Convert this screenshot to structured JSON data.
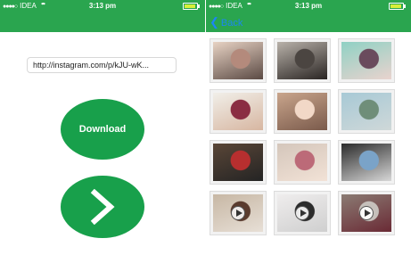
{
  "colors": {
    "brand_green": "#2aa54f",
    "button_green": "#18a04b",
    "back_blue": "#1c86f2"
  },
  "status_bar": {
    "carrier": "IDEA",
    "time": "3:13 pm",
    "battery_level": 0.9
  },
  "left_screen": {
    "url_field": {
      "value": "http://instagram.com/p/kJU-wK..."
    },
    "download_button": {
      "label": "Download"
    },
    "next_button": {
      "icon": "chevron-right-icon"
    }
  },
  "right_screen": {
    "back_button": {
      "label": "Back",
      "icon": "chevron-left-icon"
    },
    "grid": [
      {
        "kind": "photo",
        "colors": [
          "#e8d3c4",
          "#b48a7c",
          "#5b4a44"
        ]
      },
      {
        "kind": "photo",
        "colors": [
          "#b9b2aa",
          "#4b4541",
          "#2a2523"
        ]
      },
      {
        "kind": "photo",
        "colors": [
          "#8fd1c4",
          "#6a4b5d",
          "#e9d3ce"
        ]
      },
      {
        "kind": "photo",
        "colors": [
          "#f1efe9",
          "#8a2d42",
          "#d7b6a1"
        ]
      },
      {
        "kind": "photo",
        "colors": [
          "#c9a58c",
          "#f2d8c7",
          "#7a5a4b"
        ]
      },
      {
        "kind": "photo",
        "colors": [
          "#a7c9d6",
          "#6f8e79",
          "#cfd8d8"
        ]
      },
      {
        "kind": "photo",
        "colors": [
          "#5a4637",
          "#b72f2f",
          "#242424"
        ]
      },
      {
        "kind": "photo",
        "colors": [
          "#d4c6bb",
          "#bc6a78",
          "#f2e2d6"
        ]
      },
      {
        "kind": "photo",
        "colors": [
          "#2b2b2b",
          "#7aa3c8",
          "#d7d7d7"
        ]
      },
      {
        "kind": "video",
        "colors": [
          "#c7b7a4",
          "#5a3b2e",
          "#e7dfd6"
        ]
      },
      {
        "kind": "video",
        "colors": [
          "#efeded",
          "#2c2c2c",
          "#cfcfcf"
        ]
      },
      {
        "kind": "video",
        "colors": [
          "#8b7b73",
          "#c6c0bb",
          "#6a2a35"
        ]
      }
    ]
  }
}
